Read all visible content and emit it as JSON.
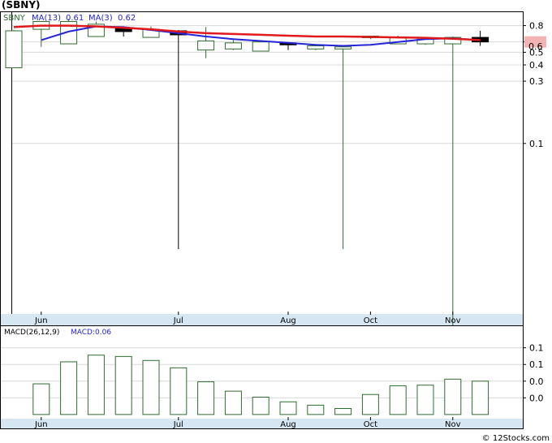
{
  "title": "(SBNY)",
  "credit": "© 12Stocks.com",
  "colors": {
    "up": "#2f6b2f",
    "down": "#000000",
    "ma13": "#2424d8",
    "ma3": "#e01a1a",
    "band": "#d6e6f2",
    "price_badge": "#f4b3b3",
    "macd_bar": "#2f6b2f"
  },
  "chart_data": [
    {
      "type": "candlestick",
      "scale": "log",
      "ticker": "SBNY",
      "legend": {
        "ticker": "SBNY",
        "ma13_label": "MA(13)",
        "ma13_value": "0.61",
        "ma3_label": "MA(3)",
        "ma3_value": "0.62"
      },
      "ylim": [
        0.005,
        1.0
      ],
      "y_ticks": [
        0.8,
        0.6,
        0.5,
        0.4,
        0.3,
        0.1
      ],
      "y_tick_labels": [
        "0.8",
        "0.6",
        "0.5",
        "0.4",
        "0.3",
        "0.1"
      ],
      "last_price": "0.6",
      "month_labels": [
        {
          "label": "Jun",
          "index": 1
        },
        {
          "label": "Jul",
          "index": 6
        },
        {
          "label": "Aug",
          "index": 10
        },
        {
          "label": "Oct",
          "index": 13
        },
        {
          "label": "Nov",
          "index": 16
        }
      ],
      "candles": [
        {
          "o": 0.38,
          "h": 0.74,
          "l": 0.38,
          "c": 0.73
        },
        {
          "o": 0.75,
          "h": 0.86,
          "l": 0.55,
          "c": 0.86
        },
        {
          "o": 0.58,
          "h": 0.9,
          "l": 0.58,
          "c": 0.86
        },
        {
          "o": 0.66,
          "h": 0.86,
          "l": 0.66,
          "c": 0.82
        },
        {
          "o": 0.76,
          "h": 0.79,
          "l": 0.66,
          "c": 0.72
        },
        {
          "o": 0.65,
          "h": 0.79,
          "l": 0.65,
          "c": 0.75
        },
        {
          "o": 0.73,
          "h": 0.74,
          "l": 0.0155,
          "c": 0.68
        },
        {
          "o": 0.52,
          "h": 0.78,
          "l": 0.45,
          "c": 0.61
        },
        {
          "o": 0.53,
          "h": 0.62,
          "l": 0.52,
          "c": 0.59
        },
        {
          "o": 0.51,
          "h": 0.61,
          "l": 0.51,
          "c": 0.6
        },
        {
          "o": 0.59,
          "h": 0.59,
          "l": 0.52,
          "c": 0.57
        },
        {
          "o": 0.53,
          "h": 0.57,
          "l": 0.52,
          "c": 0.56
        },
        {
          "o": 0.53,
          "h": 0.55,
          "l": 0.0155,
          "c": 0.55
        },
        {
          "o": 0.66,
          "h": 0.67,
          "l": 0.63,
          "c": 0.665
        },
        {
          "o": 0.58,
          "h": 0.67,
          "l": 0.58,
          "c": 0.65
        },
        {
          "o": 0.58,
          "h": 0.65,
          "l": 0.57,
          "c": 0.63
        },
        {
          "o": 0.58,
          "h": 0.66,
          "l": 0.003,
          "c": 0.65
        },
        {
          "o": 0.65,
          "h": 0.73,
          "l": 0.56,
          "c": 0.6
        }
      ],
      "ma13": [
        null,
        0.62,
        0.72,
        0.79,
        0.78,
        0.74,
        0.7,
        0.66,
        0.63,
        0.61,
        0.59,
        0.57,
        0.56,
        0.57,
        0.6,
        0.63,
        0.64,
        0.62
      ],
      "ma3": [
        0.78,
        0.8,
        0.8,
        0.79,
        0.77,
        0.75,
        0.72,
        0.7,
        0.69,
        0.68,
        0.67,
        0.66,
        0.66,
        0.655,
        0.65,
        0.645,
        0.635,
        0.62
      ]
    },
    {
      "type": "bar",
      "legend": {
        "label": "MACD(26,12,9)",
        "value_label": "MACD:0.06"
      },
      "ylim": [
        -0.005,
        0.13
      ],
      "y_ticks": [
        0.1,
        0.075,
        0.05,
        0.025
      ],
      "y_tick_labels": [
        "0.1",
        "0.1",
        "0.0",
        "0.0"
      ],
      "values": [
        0.046,
        0.079,
        0.089,
        0.087,
        0.081,
        0.07,
        0.049,
        0.035,
        0.026,
        0.019,
        0.014,
        0.009,
        0.03,
        0.043,
        0.044,
        0.053,
        0.05
      ],
      "bar_indices": [
        1,
        2,
        3,
        4,
        5,
        6,
        7,
        8,
        9,
        10,
        11,
        12,
        13,
        14,
        15,
        16,
        17
      ],
      "month_labels": [
        {
          "label": "Jun",
          "index": 1
        },
        {
          "label": "Jul",
          "index": 6
        },
        {
          "label": "Aug",
          "index": 10
        },
        {
          "label": "Oct",
          "index": 13
        },
        {
          "label": "Nov",
          "index": 16
        }
      ]
    }
  ]
}
